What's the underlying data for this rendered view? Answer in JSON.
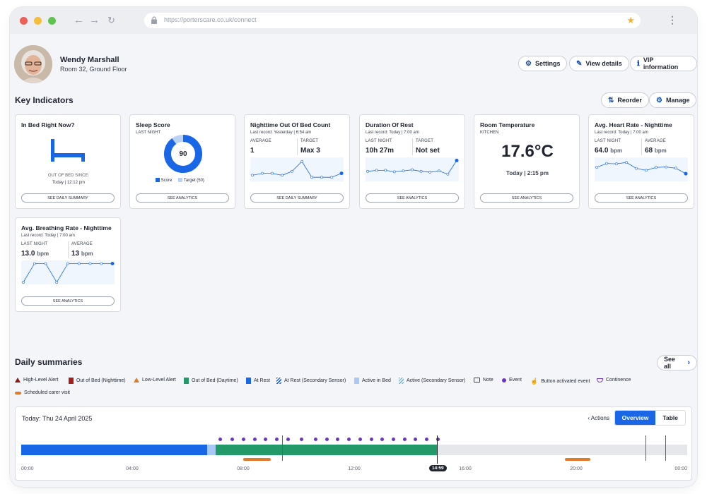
{
  "browser": {
    "url": "https://porterscare.co.uk/connect"
  },
  "patient": {
    "name": "Wendy Marshall",
    "room": "Room 32, Ground Floor"
  },
  "header_buttons": {
    "settings": "Settings",
    "view_details": "View details",
    "vip": "VIP information"
  },
  "key_indicators": {
    "title": "Key Indicators",
    "reorder": "Reorder",
    "manage": "Manage"
  },
  "cards": {
    "in_bed": {
      "title": "In Bed Right Now?",
      "since_label": "OUT OF BED SINCE:",
      "since_value": "Today | 12:12 pm",
      "button": "SEE DAILY SUMMARY"
    },
    "sleep": {
      "title": "Sleep Score",
      "subtitle": "LAST NIGHT",
      "score": "90",
      "score_fraction": 0.9,
      "target_fraction": 0.5,
      "legend_score": "Score",
      "legend_target": "Target (50)",
      "button": "SEE ANALYTICS"
    },
    "out_of_bed": {
      "title": "Nighttime Out Of Bed Count",
      "subtitle": "Last record: Yesterday | 6:54 am",
      "m1_label": "AVERAGE",
      "m1_value": "1",
      "m2_label": "TARGET",
      "m2_value": "Max 3",
      "button": "SEE DAILY SUMMARY",
      "spark": [
        2,
        3,
        3,
        2,
        4,
        9,
        1,
        1,
        1,
        3
      ]
    },
    "rest": {
      "title": "Duration Of Rest",
      "subtitle": "Last record: Today | 7:00 am",
      "m1_label": "LAST NIGHT",
      "m1_value": "10h 27m",
      "m2_label": "TARGET",
      "m2_value": "Not set",
      "button": "SEE ANALYTICS",
      "spark": [
        4,
        4.5,
        4.5,
        3.8,
        4.2,
        4.8,
        4,
        3.6,
        4.2,
        2.6,
        9.5
      ]
    },
    "temp": {
      "title": "Room Temperature",
      "subtitle": "KITCHEN",
      "value": "17.6°C",
      "time": "Today | 2:15 pm",
      "button": "SEE ANALYTICS"
    },
    "heart": {
      "title": "Avg. Heart Rate - Nighttime",
      "subtitle": "Last record: Today | 7:00 am",
      "m1_label": "LAST NIGHT",
      "m1_value": "64.0",
      "m1_unit": "bpm",
      "m2_label": "AVERAGE",
      "m2_value": "68",
      "m2_unit": "bpm",
      "button": "SEE ANALYTICS",
      "spark": [
        6,
        8,
        7.8,
        8.5,
        5.5,
        4.5,
        6,
        6.2,
        5.6,
        2.8
      ]
    },
    "breath": {
      "title": "Avg. Breathing Rate - Nighttime",
      "subtitle": "Last record: Today | 7:00 am",
      "m1_label": "LAST NIGHT",
      "m1_value": "13.0",
      "m1_unit": "bpm",
      "m2_label": "AVERAGE",
      "m2_value": "13",
      "m2_unit": "bpm",
      "button": "SEE ANALYTICS",
      "spark": [
        0,
        9,
        9,
        0,
        9,
        9,
        9,
        9,
        9
      ]
    }
  },
  "daily": {
    "title": "Daily summaries",
    "see_all": "See all"
  },
  "legend": [
    {
      "label": "High-Level Alert",
      "color": "#8b1a1a",
      "shape": "triangle"
    },
    {
      "label": "Out of Bed (Nighttime)",
      "color": "#a51d1d",
      "shape": "rect"
    },
    {
      "label": "Low-Level Alert",
      "color": "#e07b2c",
      "shape": "triangle"
    },
    {
      "label": "Out of Bed (Daytime)",
      "color": "#23996a",
      "shape": "rect"
    },
    {
      "label": "At Rest",
      "color": "#1966e6",
      "shape": "rect"
    },
    {
      "label": "At Rest (Secondary Sensor)",
      "color": "#1966e6",
      "shape": "hatch"
    },
    {
      "label": "Active in Bed",
      "color": "#a9c8f5",
      "shape": "rect"
    },
    {
      "label": "Active (Secondary Sensor)",
      "color": "#7fb8e8",
      "shape": "hatch"
    },
    {
      "label": "Note",
      "color": "#3a3f4a",
      "shape": "note"
    },
    {
      "label": "Event",
      "color": "#6a36c0",
      "shape": "dot"
    },
    {
      "label": "Button activated event",
      "color": "#6a36c0",
      "shape": "hand"
    },
    {
      "label": "Continence",
      "color": "#6a36c0",
      "shape": "cont"
    },
    {
      "label": "Scheduled carer visit",
      "color": "#e07b2c",
      "shape": "bar"
    }
  ],
  "timeline": {
    "date": "Today: Thu 24 April 2025",
    "actions": "Actions",
    "tab_overview": "Overview",
    "tab_table": "Table",
    "ticks": [
      "00:00",
      "04:00",
      "08:00",
      "12:00",
      "16:00",
      "20:00",
      "00:00"
    ],
    "now": "14:59",
    "now_hour": 14.98,
    "segments": [
      {
        "from": 0,
        "to": 6.7,
        "color": "#1966e6"
      },
      {
        "from": 6.7,
        "to": 7.0,
        "color": "#a9c8f5"
      },
      {
        "from": 7.0,
        "to": 14.98,
        "color": "#23996a"
      },
      {
        "from": 14.98,
        "to": 24,
        "color": "#e5e7ea"
      }
    ],
    "events": [
      7.15,
      7.6,
      8.0,
      8.4,
      8.8,
      9.2,
      9.6,
      10.1,
      10.6,
      11.0,
      11.4,
      11.8,
      12.2,
      12.6,
      13.0,
      13.4,
      13.8,
      14.2,
      14.6,
      15.0
    ],
    "carer_visits": [
      {
        "from": 8.0,
        "to": 9.0
      },
      {
        "from": 19.6,
        "to": 20.5
      }
    ],
    "markers": [
      9.4,
      22.5,
      23.2
    ]
  }
}
